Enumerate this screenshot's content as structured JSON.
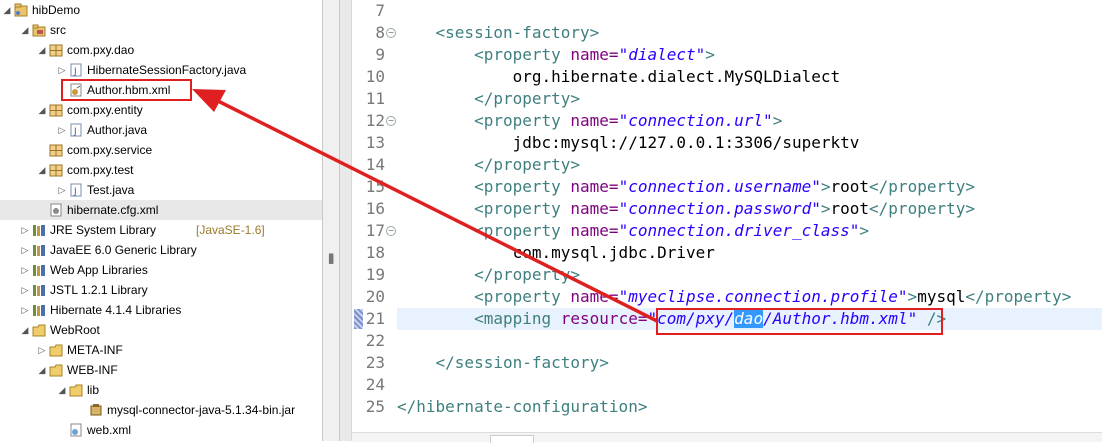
{
  "tree": {
    "items": [
      {
        "label": "hibDemo",
        "icon": "project-icon",
        "expanded": true
      },
      {
        "label": "src",
        "icon": "source-folder-icon",
        "expanded": true
      },
      {
        "label": "com.pxy.dao",
        "icon": "package-icon",
        "expanded": true
      },
      {
        "label": "HibernateSessionFactory.java",
        "icon": "java-file-icon",
        "expanded": false
      },
      {
        "label": "Author.hbm.xml",
        "icon": "hbm-xml-file-icon"
      },
      {
        "label": "com.pxy.entity",
        "icon": "package-icon",
        "expanded": true
      },
      {
        "label": "Author.java",
        "icon": "java-file-icon",
        "expanded": false
      },
      {
        "label": "com.pxy.service",
        "icon": "package-icon"
      },
      {
        "label": "com.pxy.test",
        "icon": "package-icon",
        "expanded": true
      },
      {
        "label": "Test.java",
        "icon": "java-file-icon",
        "expanded": false
      },
      {
        "label": "hibernate.cfg.xml",
        "icon": "hibernate-config-icon"
      },
      {
        "label": "JRE System Library",
        "decoration": "[JavaSE-1.6]",
        "icon": "library-icon",
        "expanded": false
      },
      {
        "label": "JavaEE 6.0 Generic Library",
        "icon": "library-icon",
        "expanded": false
      },
      {
        "label": "Web App Libraries",
        "icon": "library-icon",
        "expanded": false
      },
      {
        "label": "JSTL 1.2.1 Library",
        "icon": "library-icon",
        "expanded": false
      },
      {
        "label": "Hibernate 4.1.4 Libraries",
        "icon": "library-icon",
        "expanded": false
      },
      {
        "label": "WebRoot",
        "icon": "folder-icon",
        "expanded": true
      },
      {
        "label": "META-INF",
        "icon": "folder-icon",
        "expanded": false
      },
      {
        "label": "WEB-INF",
        "icon": "folder-icon",
        "expanded": true
      },
      {
        "label": "lib",
        "icon": "folder-icon",
        "expanded": true
      },
      {
        "label": "mysql-connector-java-5.1.34-bin.jar",
        "icon": "jar-icon"
      },
      {
        "label": "web.xml",
        "icon": "xml-file-icon"
      }
    ]
  },
  "editor": {
    "lines": [
      {
        "n": "7",
        "parts": []
      },
      {
        "n": "8",
        "parts": [
          {
            "c": "tag",
            "t": "    <session-factory>"
          }
        ]
      },
      {
        "n": "9",
        "parts": [
          {
            "c": "tag",
            "t": "        <property "
          },
          {
            "c": "attr",
            "t": "name="
          },
          {
            "c": "val",
            "t": "\"dialect\""
          },
          {
            "c": "tag",
            "t": ">"
          }
        ]
      },
      {
        "n": "10",
        "parts": [
          {
            "c": "txt",
            "t": "            org.hibernate.dialect.MySQLDialect"
          }
        ]
      },
      {
        "n": "11",
        "parts": [
          {
            "c": "tag",
            "t": "        </property>"
          }
        ]
      },
      {
        "n": "12",
        "parts": [
          {
            "c": "tag",
            "t": "        <property "
          },
          {
            "c": "attr",
            "t": "name="
          },
          {
            "c": "val",
            "t": "\"connection.url\""
          },
          {
            "c": "tag",
            "t": ">"
          }
        ]
      },
      {
        "n": "13",
        "parts": [
          {
            "c": "txt",
            "t": "            jdbc:mysql://127.0.0.1:3306/superktv"
          }
        ]
      },
      {
        "n": "14",
        "parts": [
          {
            "c": "tag",
            "t": "        </property>"
          }
        ]
      },
      {
        "n": "15",
        "parts": [
          {
            "c": "tag",
            "t": "        <property "
          },
          {
            "c": "attr",
            "t": "name="
          },
          {
            "c": "val",
            "t": "\"connection.username\""
          },
          {
            "c": "tag",
            "t": ">"
          },
          {
            "c": "txt",
            "t": "root"
          },
          {
            "c": "tag",
            "t": "</property>"
          }
        ]
      },
      {
        "n": "16",
        "parts": [
          {
            "c": "tag",
            "t": "        <property "
          },
          {
            "c": "attr",
            "t": "name="
          },
          {
            "c": "val",
            "t": "\"connection.password\""
          },
          {
            "c": "tag",
            "t": ">"
          },
          {
            "c": "txt",
            "t": "root"
          },
          {
            "c": "tag",
            "t": "</property>"
          }
        ]
      },
      {
        "n": "17",
        "parts": [
          {
            "c": "tag",
            "t": "        <property "
          },
          {
            "c": "attr",
            "t": "name="
          },
          {
            "c": "val",
            "t": "\"connection.driver_class\""
          },
          {
            "c": "tag",
            "t": ">"
          }
        ]
      },
      {
        "n": "18",
        "parts": [
          {
            "c": "txt",
            "t": "            com.mysql.jdbc.Driver"
          }
        ]
      },
      {
        "n": "19",
        "parts": [
          {
            "c": "tag",
            "t": "        </property>"
          }
        ]
      },
      {
        "n": "20",
        "parts": [
          {
            "c": "tag",
            "t": "        <property "
          },
          {
            "c": "attr",
            "t": "name="
          },
          {
            "c": "val",
            "t": "\"myeclipse.connection.profile\""
          },
          {
            "c": "tag",
            "t": ">"
          },
          {
            "c": "txt",
            "t": "mysql"
          },
          {
            "c": "tag",
            "t": "</property>"
          }
        ]
      },
      {
        "n": "21",
        "parts": [
          {
            "c": "tag",
            "t": "        <mapping "
          },
          {
            "c": "attr",
            "t": "resource="
          },
          {
            "c": "val",
            "t": "\"com/pxy/"
          },
          {
            "c": "val hl",
            "t": "dao"
          },
          {
            "c": "val",
            "t": "/Author.hbm.xml\""
          },
          {
            "c": "tag",
            "t": " />"
          }
        ]
      },
      {
        "n": "22",
        "parts": []
      },
      {
        "n": "23",
        "parts": [
          {
            "c": "tag",
            "t": "    </session-factory>"
          }
        ]
      },
      {
        "n": "24",
        "parts": []
      },
      {
        "n": "25",
        "parts": [
          {
            "c": "tag",
            "t": "</hibernate-configuration>"
          }
        ]
      }
    ]
  },
  "colors": {
    "annotation": "#e02020",
    "tag": "#3f7f7f",
    "attr": "#7f007f",
    "value": "#2a00ff",
    "selection": "#3399ff"
  }
}
